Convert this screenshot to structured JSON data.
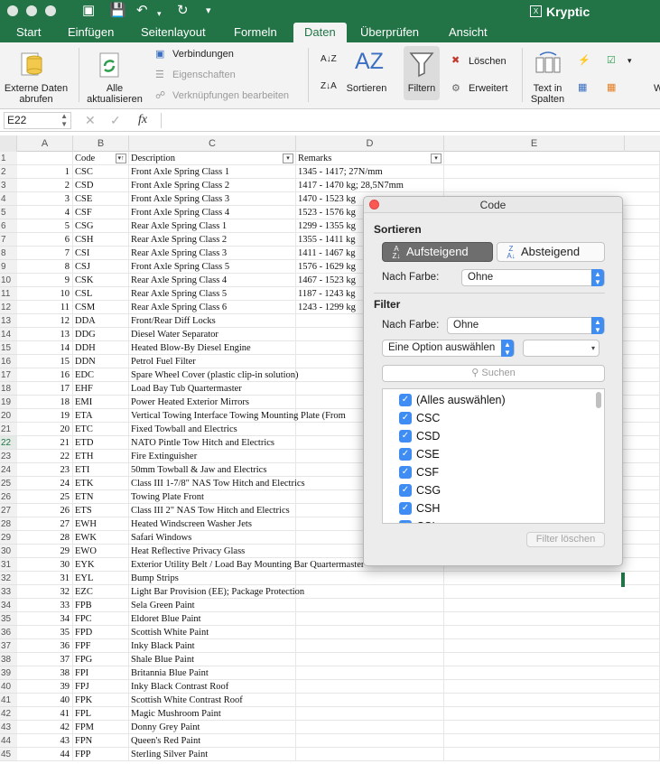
{
  "app": {
    "title": "Kryptic"
  },
  "tabs": [
    "Start",
    "Einfügen",
    "Seitenlayout",
    "Formeln",
    "Daten",
    "Überprüfen",
    "Ansicht"
  ],
  "ribbon": {
    "external": "Externe Daten abrufen",
    "refresh": "Alle aktualisieren",
    "connections": "Verbindungen",
    "properties": "Eigenschaften",
    "edit_links": "Verknüpfungen bearbeiten",
    "sort": "Sortieren",
    "filter": "Filtern",
    "clear": "Löschen",
    "advanced": "Erweitert",
    "text_to_columns": "Text in Spalten",
    "more": "W"
  },
  "formula": {
    "cell": "E22",
    "fx": "fx",
    "value": ""
  },
  "columns": [
    "A",
    "B",
    "C",
    "D",
    "E"
  ],
  "header_row": {
    "code": "Code",
    "description": "Description",
    "remarks": "Remarks"
  },
  "rows": [
    {
      "n": 1,
      "code": "CSC",
      "desc": "Front Axle Spring Class 1",
      "rem": "1345 - 1417; 27N/mm"
    },
    {
      "n": 2,
      "code": "CSD",
      "desc": "Front Axle Spring Class 2",
      "rem": "1417 - 1470 kg; 28,5N7mm"
    },
    {
      "n": 3,
      "code": "CSE",
      "desc": "Front Axle Spring Class 3",
      "rem": "1470 - 1523 kg"
    },
    {
      "n": 4,
      "code": "CSF",
      "desc": "Front Axle Spring Class 4",
      "rem": "1523 - 1576 kg"
    },
    {
      "n": 5,
      "code": "CSG",
      "desc": "Rear Axle Spring Class 1",
      "rem": "1299 - 1355 kg"
    },
    {
      "n": 6,
      "code": "CSH",
      "desc": "Rear Axle Spring Class 2",
      "rem": "1355 - 1411 kg"
    },
    {
      "n": 7,
      "code": "CSI",
      "desc": "Rear Axle Spring Class 3",
      "rem": "1411 - 1467 kg"
    },
    {
      "n": 8,
      "code": "CSJ",
      "desc": "Front Axle Spring Class 5",
      "rem": "1576 - 1629 kg"
    },
    {
      "n": 9,
      "code": "CSK",
      "desc": "Rear Axle Spring Class 4",
      "rem": "1467 - 1523 kg"
    },
    {
      "n": 10,
      "code": "CSL",
      "desc": "Rear Axle Spring Class 5",
      "rem": "1187 - 1243 kg"
    },
    {
      "n": 11,
      "code": "CSM",
      "desc": "Rear Axle Spring Class 6",
      "rem": "1243 - 1299 kg"
    },
    {
      "n": 12,
      "code": "DDA",
      "desc": "Front/Rear Diff Locks",
      "rem": ""
    },
    {
      "n": 13,
      "code": "DDG",
      "desc": "Diesel Water Separator",
      "rem": ""
    },
    {
      "n": 14,
      "code": "DDH",
      "desc": "Heated Blow-By Diesel Engine",
      "rem": ""
    },
    {
      "n": 15,
      "code": "DDN",
      "desc": "Petrol Fuel Filter",
      "rem": ""
    },
    {
      "n": 16,
      "code": "EDC",
      "desc": "Spare Wheel Cover (plastic clip-in solution)",
      "rem": ""
    },
    {
      "n": 17,
      "code": "EHF",
      "desc": "Load Bay Tub Quartermaster",
      "rem": ""
    },
    {
      "n": 18,
      "code": "EMI",
      "desc": "Power Heated Exterior Mirrors",
      "rem": ""
    },
    {
      "n": 19,
      "code": "ETA",
      "desc": "Vertical Towing Interface Towing Mounting Plate (From",
      "rem": ""
    },
    {
      "n": 20,
      "code": "ETC",
      "desc": "Fixed Towball and Electrics",
      "rem": ""
    },
    {
      "n": 21,
      "code": "ETD",
      "desc": "NATO Pintle Tow Hitch and Electrics",
      "rem": ""
    },
    {
      "n": 22,
      "code": "ETH",
      "desc": "Fire Extinguisher",
      "rem": ""
    },
    {
      "n": 23,
      "code": "ETI",
      "desc": "50mm Towball & Jaw and Electrics",
      "rem": ""
    },
    {
      "n": 24,
      "code": "ETK",
      "desc": "Class III 1-7/8\" NAS Tow Hitch and Electrics",
      "rem": ""
    },
    {
      "n": 25,
      "code": "ETN",
      "desc": "Towing Plate Front",
      "rem": ""
    },
    {
      "n": 26,
      "code": "ETS",
      "desc": "Class III 2\" NAS Tow Hitch and Electrics",
      "rem": ""
    },
    {
      "n": 27,
      "code": "EWH",
      "desc": "Heated Windscreen Washer Jets",
      "rem": ""
    },
    {
      "n": 28,
      "code": "EWK",
      "desc": "Safari Windows",
      "rem": ""
    },
    {
      "n": 29,
      "code": "EWO",
      "desc": "Heat Reflective Privacy Glass",
      "rem": ""
    },
    {
      "n": 30,
      "code": "EYK",
      "desc": " Exterior Utility Belt / Load Bay Mounting Bar Quartermaster",
      "rem": ""
    },
    {
      "n": 31,
      "code": "EYL",
      "desc": "Bump Strips",
      "rem": ""
    },
    {
      "n": 32,
      "code": "EZC",
      "desc": "Light Bar Provision (EE); Package Protection",
      "rem": ""
    },
    {
      "n": 33,
      "code": "FPB",
      "desc": "Sela Green Paint",
      "rem": ""
    },
    {
      "n": 34,
      "code": "FPC",
      "desc": "Eldoret Blue Paint",
      "rem": ""
    },
    {
      "n": 35,
      "code": "FPD",
      "desc": "Scottish White Paint",
      "rem": ""
    },
    {
      "n": 36,
      "code": "FPF",
      "desc": "Inky Black Paint",
      "rem": ""
    },
    {
      "n": 37,
      "code": "FPG",
      "desc": "Shale Blue Paint",
      "rem": ""
    },
    {
      "n": 38,
      "code": "FPI",
      "desc": "Britannia Blue Paint",
      "rem": ""
    },
    {
      "n": 39,
      "code": "FPJ",
      "desc": "Inky Black Contrast Roof",
      "rem": ""
    },
    {
      "n": 40,
      "code": "FPK",
      "desc": "Scottish White Contrast Roof",
      "rem": ""
    },
    {
      "n": 41,
      "code": "FPL",
      "desc": "Magic Mushroom Paint",
      "rem": ""
    },
    {
      "n": 42,
      "code": "FPM",
      "desc": "Donny Grey Paint",
      "rem": ""
    },
    {
      "n": 43,
      "code": "FPN",
      "desc": "Queen's Red Paint",
      "rem": ""
    },
    {
      "n": 44,
      "code": "FPP",
      "desc": "Sterling Silver Paint",
      "rem": ""
    }
  ],
  "popup": {
    "title": "Code",
    "sort_heading": "Sortieren",
    "ascending": "Aufsteigend",
    "descending": "Absteigend",
    "by_color_label": "Nach Farbe:",
    "sort_color": "Ohne",
    "filter_heading": "Filter",
    "filter_color": "Ohne",
    "option_select": "Eine Option auswählen",
    "option_value": "",
    "search_placeholder": "Suchen",
    "items": [
      "(Alles auswählen)",
      "CSC",
      "CSD",
      "CSE",
      "CSF",
      "CSG",
      "CSH",
      "CSI"
    ],
    "clear_filter": "Filter löschen"
  },
  "colors": {
    "accent": "#227447",
    "checkbox": "#3f8cf3",
    "close": "#fc5753"
  }
}
